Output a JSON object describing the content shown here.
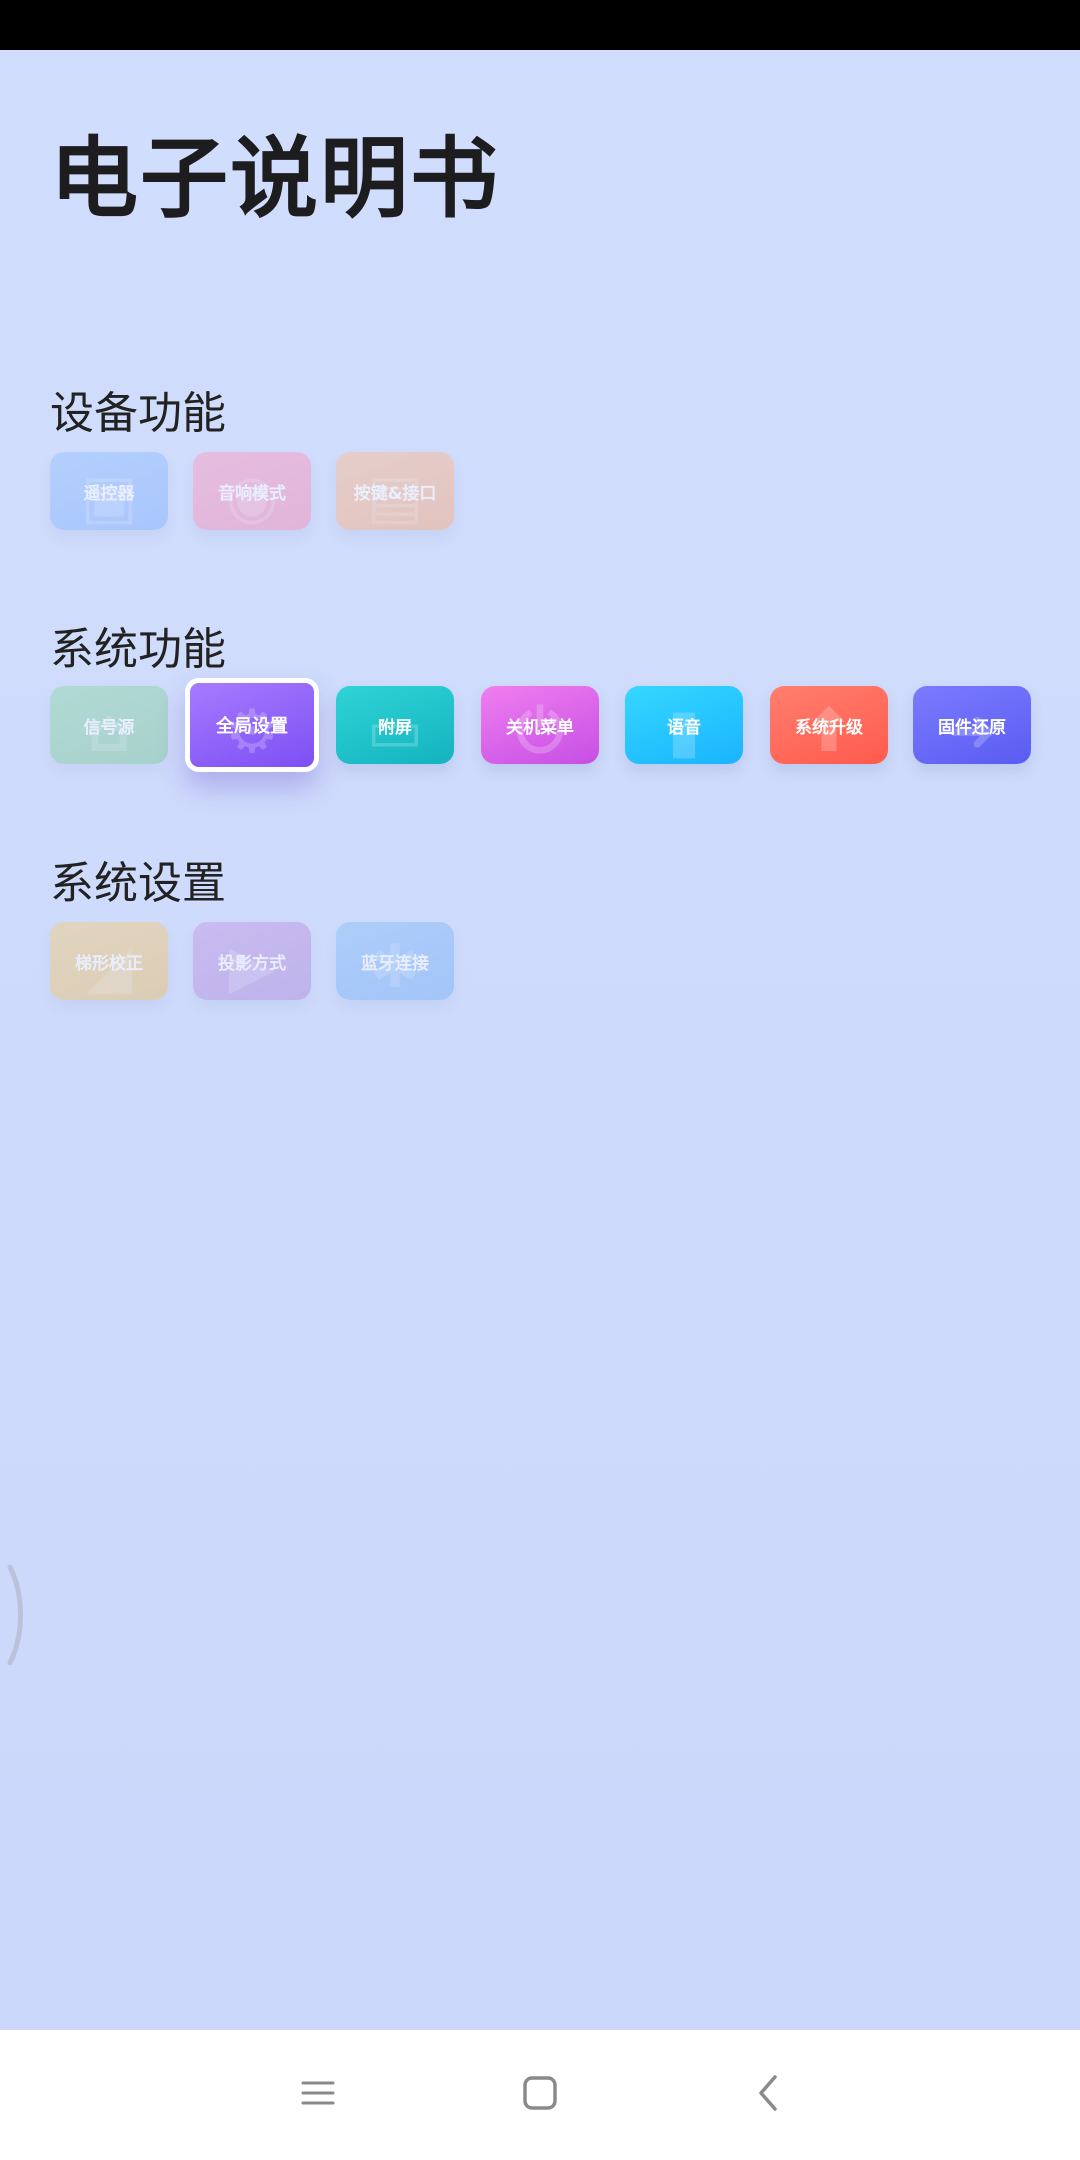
{
  "page_title": "电子说明书",
  "sections": [
    {
      "title": "设备功能",
      "items": [
        {
          "label": "遥控器",
          "icon": "remote-icon",
          "glyph": "▣",
          "color_from": "#9ec6ff",
          "color_to": "#8ab5ff"
        },
        {
          "label": "音响模式",
          "icon": "speaker-icon",
          "glyph": "◉",
          "color_from": "#f7a5c9",
          "color_to": "#f194bf"
        },
        {
          "label": "按键&接口",
          "icon": "ports-icon",
          "glyph": "▤",
          "color_from": "#f7c3a2",
          "color_to": "#f2b08c"
        }
      ]
    },
    {
      "title": "系统功能",
      "items": [
        {
          "label": "信号源",
          "icon": "signal-source-icon",
          "glyph": "⌂",
          "color_from": "#9ad9b6",
          "color_to": "#88c9a6"
        },
        {
          "label": "全局设置",
          "icon": "gear-icon",
          "glyph": "⚙",
          "color_from": "#a77bff",
          "color_to": "#7d4ff4"
        },
        {
          "label": "附屏",
          "icon": "screen-icon",
          "glyph": "▭",
          "color_from": "#2fd4d6",
          "color_to": "#14b3bf"
        },
        {
          "label": "关机菜单",
          "icon": "power-icon",
          "glyph": "⏻",
          "color_from": "#f07ef0",
          "color_to": "#c64fe4"
        },
        {
          "label": "语音",
          "icon": "voice-icon",
          "glyph": "▮",
          "color_from": "#35d7ff",
          "color_to": "#1ab4ff"
        },
        {
          "label": "系统升级",
          "icon": "upgrade-icon",
          "glyph": "⬆",
          "color_from": "#ff7f6e",
          "color_to": "#ff5a4d"
        },
        {
          "label": "固件还原",
          "icon": "restore-icon",
          "glyph": "➜",
          "color_from": "#7b7bff",
          "color_to": "#5a5cf2"
        }
      ]
    },
    {
      "title": "系统设置",
      "items": [
        {
          "label": "梯形校正",
          "icon": "keystone-icon",
          "glyph": "◢",
          "color_from": "#f2d18f",
          "color_to": "#e8c17d"
        },
        {
          "label": "投影方式",
          "icon": "projection-icon",
          "glyph": "▶",
          "color_from": "#c4a2e8",
          "color_to": "#b293dd"
        },
        {
          "label": "蓝牙连接",
          "icon": "bluetooth-icon",
          "glyph": "✱",
          "color_from": "#94c3fb",
          "color_to": "#7fb3f6"
        }
      ]
    }
  ],
  "selected_item": "全局设置",
  "nav": {
    "menu_icon": "menu-icon",
    "home_icon": "home-icon",
    "back_icon": "back-icon"
  }
}
